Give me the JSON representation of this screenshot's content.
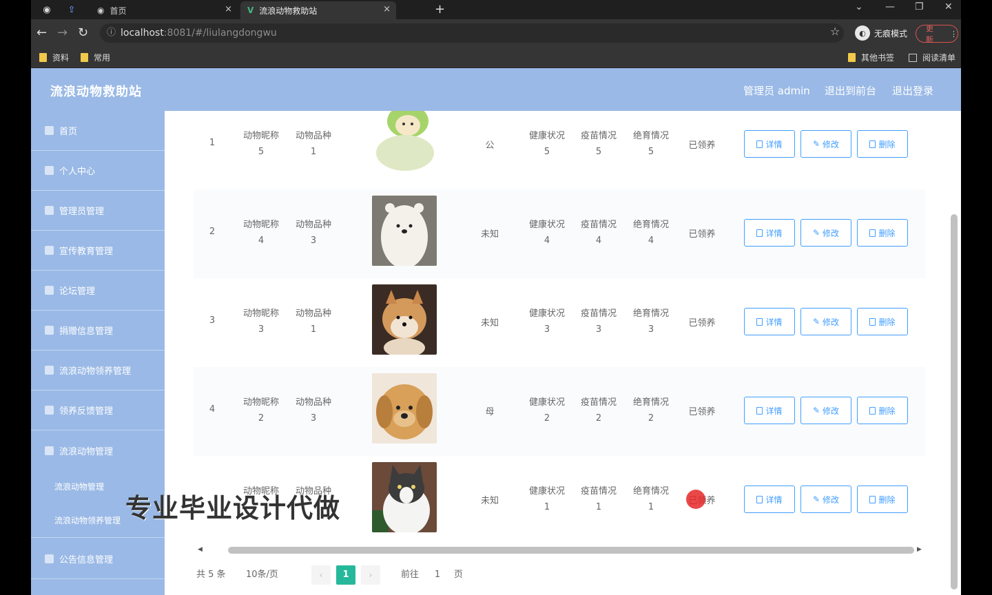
{
  "browser": {
    "tabs": [
      {
        "label": "首页",
        "active": false
      },
      {
        "label": "流浪动物救助站",
        "active": true
      }
    ],
    "url_host": "localhost",
    "url_rest": ":8081/#/liulangdongwu",
    "incognito_label": "无痕模式",
    "update_label": "更新",
    "bookmarks": [
      "资料",
      "常用"
    ],
    "bookmarks_right": [
      "其他书签",
      "阅读清单"
    ]
  },
  "app": {
    "brand": "流浪动物救助站",
    "header_links": [
      "管理员 admin",
      "退出到前台",
      "退出登录"
    ],
    "sidebar": [
      "首页",
      "个人中心",
      "管理员管理",
      "宣传教育管理",
      "论坛管理",
      "捐赠信息管理",
      "流浪动物领养管理",
      "领养反馈管理",
      "流浪动物管理",
      "流浪动物管理",
      "流浪动物领养管理",
      "公告信息管理"
    ]
  },
  "table": {
    "rows": [
      {
        "index": "1",
        "nickname_label": "动物昵称",
        "nickname": "5",
        "breed_label": "动物品种",
        "breed": "1",
        "photo": "cabbage-dog",
        "gender": "公",
        "health_label": "健康状况",
        "health": "5",
        "vaccine_label": "疫苗情况",
        "vaccine": "5",
        "sterile_label": "绝育情况",
        "sterile": "5",
        "status": "已领养"
      },
      {
        "index": "2",
        "nickname_label": "动物昵称",
        "nickname": "4",
        "breed_label": "动物品种",
        "breed": "3",
        "photo": "polar-bear",
        "gender": "未知",
        "health_label": "健康状况",
        "health": "4",
        "vaccine_label": "疫苗情况",
        "vaccine": "4",
        "sterile_label": "绝育情况",
        "sterile": "4",
        "status": "已领养"
      },
      {
        "index": "3",
        "nickname_label": "动物昵称",
        "nickname": "3",
        "breed_label": "动物品种",
        "breed": "1",
        "photo": "shiba-dog",
        "gender": "未知",
        "health_label": "健康状况",
        "health": "3",
        "vaccine_label": "疫苗情况",
        "vaccine": "3",
        "sterile_label": "绝育情况",
        "sterile": "3",
        "status": "已领养"
      },
      {
        "index": "4",
        "nickname_label": "动物昵称",
        "nickname": "2",
        "breed_label": "动物品种",
        "breed": "3",
        "photo": "golden-puppy",
        "gender": "母",
        "health_label": "健康状况",
        "health": "2",
        "vaccine_label": "疫苗情况",
        "vaccine": "2",
        "sterile_label": "绝育情况",
        "sterile": "2",
        "status": "已领养"
      },
      {
        "index": "",
        "nickname_label": "动物昵称",
        "nickname": "",
        "breed_label": "动物品种",
        "breed": "",
        "photo": "cat",
        "gender": "未知",
        "health_label": "健康状况",
        "health": "1",
        "vaccine_label": "疫苗情况",
        "vaccine": "1",
        "sterile_label": "绝育情况",
        "sterile": "1",
        "status": "已领养"
      }
    ],
    "actions": {
      "detail": "详情",
      "edit": "修改",
      "delete": "删除"
    }
  },
  "pagination": {
    "total": "共 5 条",
    "page_size": "10条/页",
    "current_page": "1",
    "goto_label": "前往",
    "goto_value": "1",
    "page_suffix": "页"
  },
  "watermark": "专业毕业设计代做"
}
